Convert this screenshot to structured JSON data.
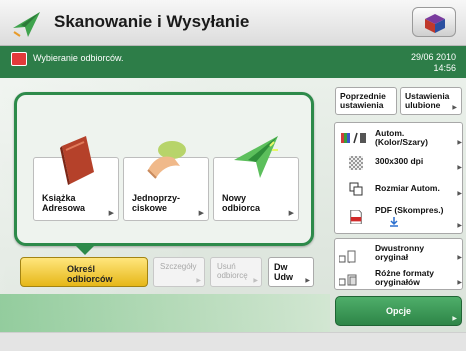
{
  "header": {
    "title": "Skanowanie i Wysyłanie",
    "app_icon": "paper-plane-icon",
    "menu_icon": "cube-menu-icon"
  },
  "status": {
    "message": "Wybieranie odbiorców.",
    "date": "29/06 2010",
    "time": "14:56",
    "icon": "warning-icon"
  },
  "destinations": [
    {
      "label": "Książka\nAdresowa",
      "icon": "address-book-icon"
    },
    {
      "label": "Jednoprzy-\nciskowe",
      "icon": "one-touch-icon"
    },
    {
      "label": "Nowy\nodbiorca",
      "icon": "new-recipient-icon"
    }
  ],
  "actions": {
    "specify": "Określ\nodbiorców",
    "details": "Szczegóły",
    "delete": "Usuń\nodbiorcę",
    "dw": "Dw\nUdw"
  },
  "right": {
    "previous": "Poprzednie\nustawienia",
    "favorites": "Ustawienia\nulubione",
    "color_mode": "Autom.\n(Kolor/Szary)",
    "resolution": "300x300 dpi",
    "size": "Rozmiar Autom.",
    "format": "PDF (Skompres.)",
    "duplex": "Dwustronny\noryginał",
    "mixed": "Różne formaty\noryginałów",
    "options": "Opcje"
  },
  "colors": {
    "accent_green": "#2d7d48",
    "select_yellow": "#f2cc3a"
  }
}
